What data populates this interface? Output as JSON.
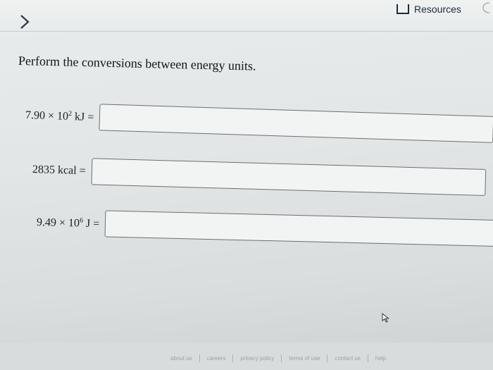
{
  "header": {
    "resources_label": "Resources"
  },
  "question": {
    "instruction": "Perform the conversions between energy units.",
    "rows": [
      {
        "coef": "7.90 × 10",
        "exp": "2",
        "unit": " kJ",
        "equals": "="
      },
      {
        "coef": "2835",
        "exp": "",
        "unit": " kcal",
        "equals": "="
      },
      {
        "coef": "9.49 × 10",
        "exp": "6",
        "unit": " J",
        "equals": "="
      }
    ]
  },
  "footer": {
    "links": [
      "about us",
      "careers",
      "privacy policy",
      "terms of use",
      "contact us",
      "help"
    ]
  },
  "icons": {
    "back": "chevron-right-icon",
    "resources": "bookmark-box-icon",
    "cursor": "mouse-pointer-icon"
  }
}
